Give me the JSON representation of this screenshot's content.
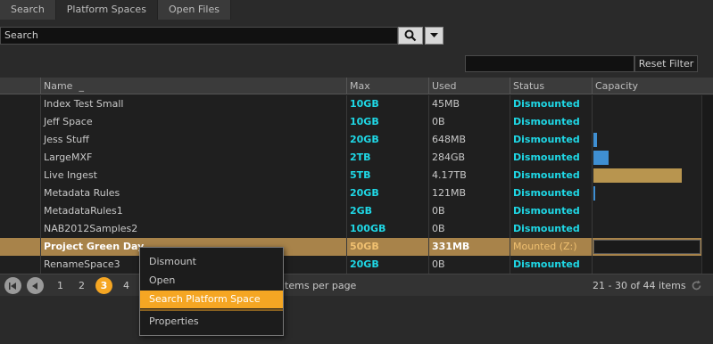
{
  "tabs": [
    {
      "label": "Search"
    },
    {
      "label": "Platform Spaces"
    },
    {
      "label": "Open Files"
    }
  ],
  "search": {
    "value": "Search",
    "icon": "search-icon",
    "dropdown_icon": "caret-down-icon"
  },
  "filter": {
    "value": "",
    "reset_label": "Reset Filter"
  },
  "columns": {
    "name": "Name",
    "max": "Max",
    "used": "Used",
    "status": "Status",
    "capacity": "Capacity"
  },
  "rows": [
    {
      "name": "Index Test Small",
      "max": "10GB",
      "used": "45MB",
      "status": "Dismounted",
      "capacity_fraction": 0.0,
      "selected": false
    },
    {
      "name": "Jeff Space",
      "max": "10GB",
      "used": "0B",
      "status": "Dismounted",
      "capacity_fraction": 0.0,
      "selected": false
    },
    {
      "name": "Jess Stuff",
      "max": "20GB",
      "used": "648MB",
      "status": "Dismounted",
      "capacity_fraction": 0.032,
      "selected": false
    },
    {
      "name": "LargeMXF",
      "max": "2TB",
      "used": "284GB",
      "status": "Dismounted",
      "capacity_fraction": 0.139,
      "selected": false
    },
    {
      "name": "Live Ingest",
      "max": "5TB",
      "used": "4.17TB",
      "status": "Dismounted",
      "capacity_fraction": 0.834,
      "selected": false
    },
    {
      "name": "Metadata Rules",
      "max": "20GB",
      "used": "121MB",
      "status": "Dismounted",
      "capacity_fraction": 0.006,
      "selected": false
    },
    {
      "name": "MetadataRules1",
      "max": "2GB",
      "used": "0B",
      "status": "Dismounted",
      "capacity_fraction": 0.0,
      "selected": false
    },
    {
      "name": "NAB2012Samples2",
      "max": "100GB",
      "used": "0B",
      "status": "Dismounted",
      "capacity_fraction": 0.0,
      "selected": false
    },
    {
      "name": "Project Green Day",
      "max": "50GB",
      "used": "331MB",
      "status": "Mounted (Z:)",
      "capacity_fraction": 0.007,
      "selected": true
    },
    {
      "name": "RenameSpace3",
      "max": "20GB",
      "used": "0B",
      "status": "Dismounted",
      "capacity_fraction": 0.0,
      "selected": false
    }
  ],
  "colors": {
    "accent": "#f5a623",
    "cyan": "#1fd8e6",
    "selected_row": "#a8834a",
    "cap_blue": "#3f8fd2",
    "cap_tan": "#b8954f"
  },
  "pager": {
    "pages": [
      "1",
      "2",
      "3",
      "4"
    ],
    "current_page": "3",
    "items_per_page_label": "items per page",
    "count_label": "21 - 30 of 44 items"
  },
  "context_menu": {
    "items": [
      "Dismount",
      "Open",
      "Search Platform Space",
      "Properties"
    ],
    "active": "Search Platform Space"
  }
}
